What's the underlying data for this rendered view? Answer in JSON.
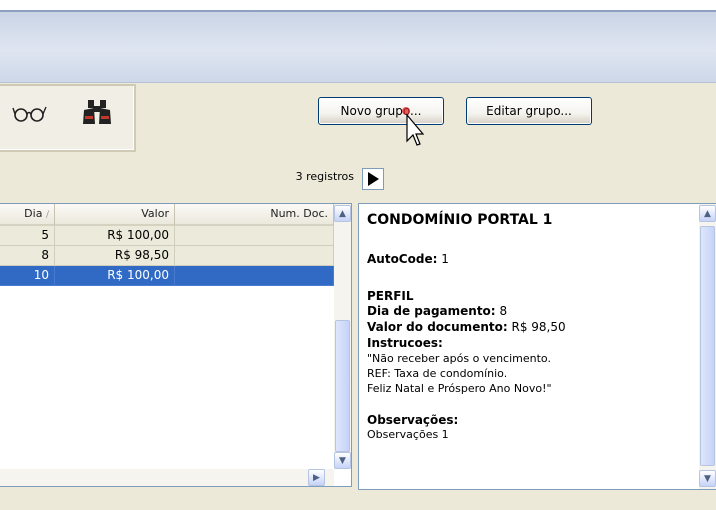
{
  "toolbar": {
    "novo_grupo_label": "Novo grupo...",
    "editar_grupo_label": "Editar grupo..."
  },
  "records": {
    "count_label": "3 registros"
  },
  "grid": {
    "columns": [
      "Dia",
      "Valor",
      "Num. Doc."
    ],
    "rows": [
      {
        "dia": "5",
        "valor": "R$ 100,00",
        "num_doc": ""
      },
      {
        "dia": "8",
        "valor": "R$ 98,50",
        "num_doc": ""
      },
      {
        "dia": "10",
        "valor": "R$ 100,00",
        "num_doc": ""
      }
    ],
    "selected_row": 2
  },
  "detail": {
    "title": "CONDOMÍNIO PORTAL 1",
    "autocode_label": "AutoCode:",
    "autocode_value": "1",
    "perfil_heading": "PERFIL",
    "dia_label": "Dia de pagamento:",
    "dia_value": "8",
    "valor_label": "Valor do documento:",
    "valor_value": "R$ 98,50",
    "instrucoes_label": "Instrucoes:",
    "instrucoes_lines": [
      "\"Não receber após o vencimento.",
      "REF: Taxa de condomínio.",
      "Feliz Natal e Próspero Ano Novo!\""
    ],
    "observacoes_label": "Observações:",
    "observacoes_value": "Observações 1"
  },
  "icons": [
    "glasses-icon",
    "binoculars-icon",
    "mouse-cursor-icon"
  ],
  "colors": {
    "selection": "#316ac5",
    "alt_row": "#ebeadb",
    "header_band": "#dfe6f1"
  }
}
